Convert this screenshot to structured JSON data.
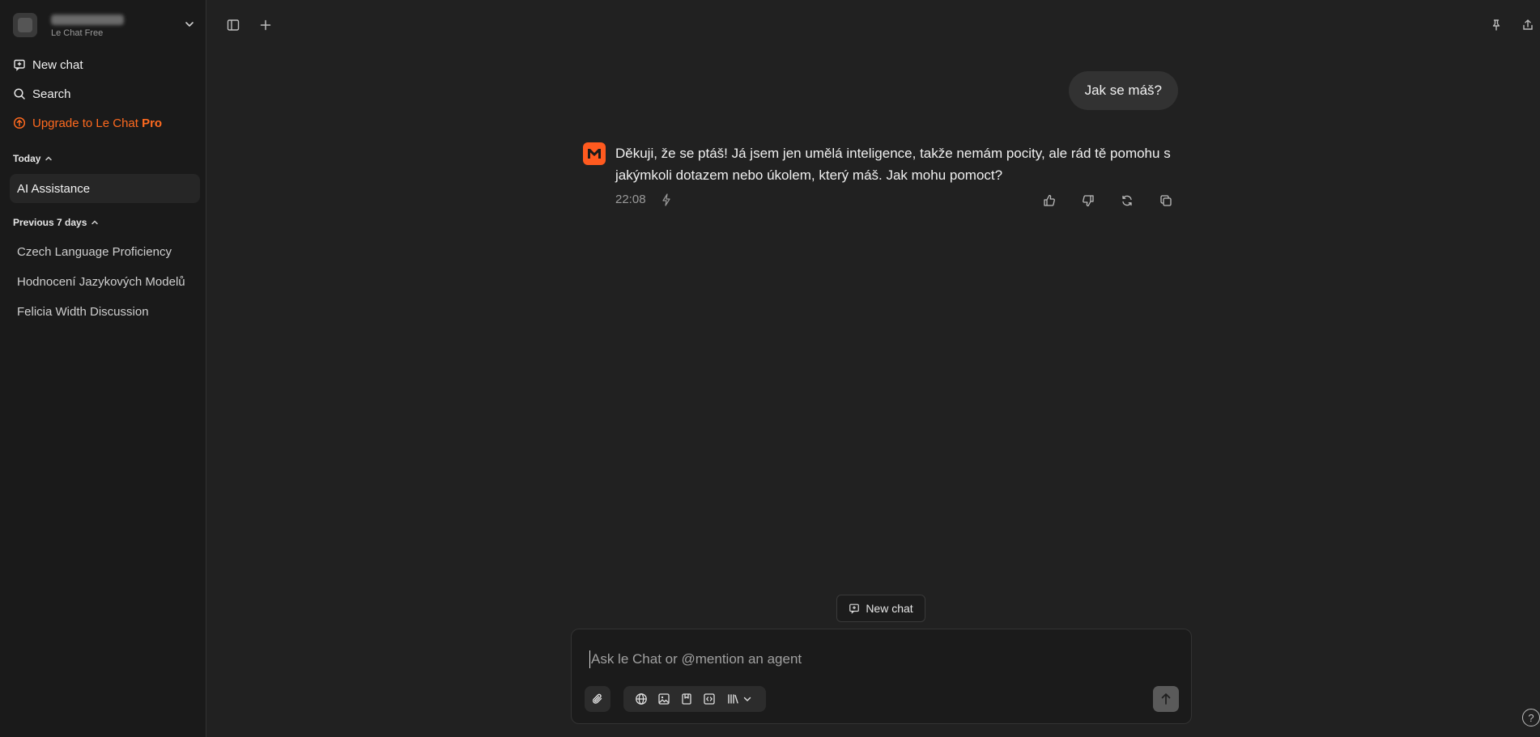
{
  "account": {
    "plan": "Le Chat Free"
  },
  "sidebar": {
    "nav": [
      {
        "label": "New chat",
        "icon": "new-chat-icon"
      },
      {
        "label": "Search",
        "icon": "search-icon"
      },
      {
        "label_prefix": "Upgrade to Le Chat ",
        "label_strong": "Pro",
        "icon": "upgrade-icon",
        "color": "#ff6a1f"
      }
    ],
    "sections": [
      {
        "title": "Today",
        "items": [
          "AI Assistance"
        ]
      },
      {
        "title": "Previous 7 days",
        "items": [
          "Czech Language Proficiency",
          "Hodnocení Jazykových Modelů",
          "Felicia Width Discussion"
        ]
      }
    ]
  },
  "conversation": {
    "user_message": "Jak se máš?",
    "assistant_message": "Děkuji, že se ptáš! Já jsem jen umělá inteligence, takže nemám pocity, ale rád tě pomohu s jakýmkoli dotazem nebo úkolem, který máš. Jak mohu pomoct?",
    "timestamp": "22:08"
  },
  "new_chat_pill": "New chat",
  "composer": {
    "placeholder": "Ask le Chat or @mention an agent"
  },
  "help_label": "?",
  "colors": {
    "accent": "#ff5a1f",
    "background": "#212121",
    "sidebar": "#1a1a1a"
  }
}
